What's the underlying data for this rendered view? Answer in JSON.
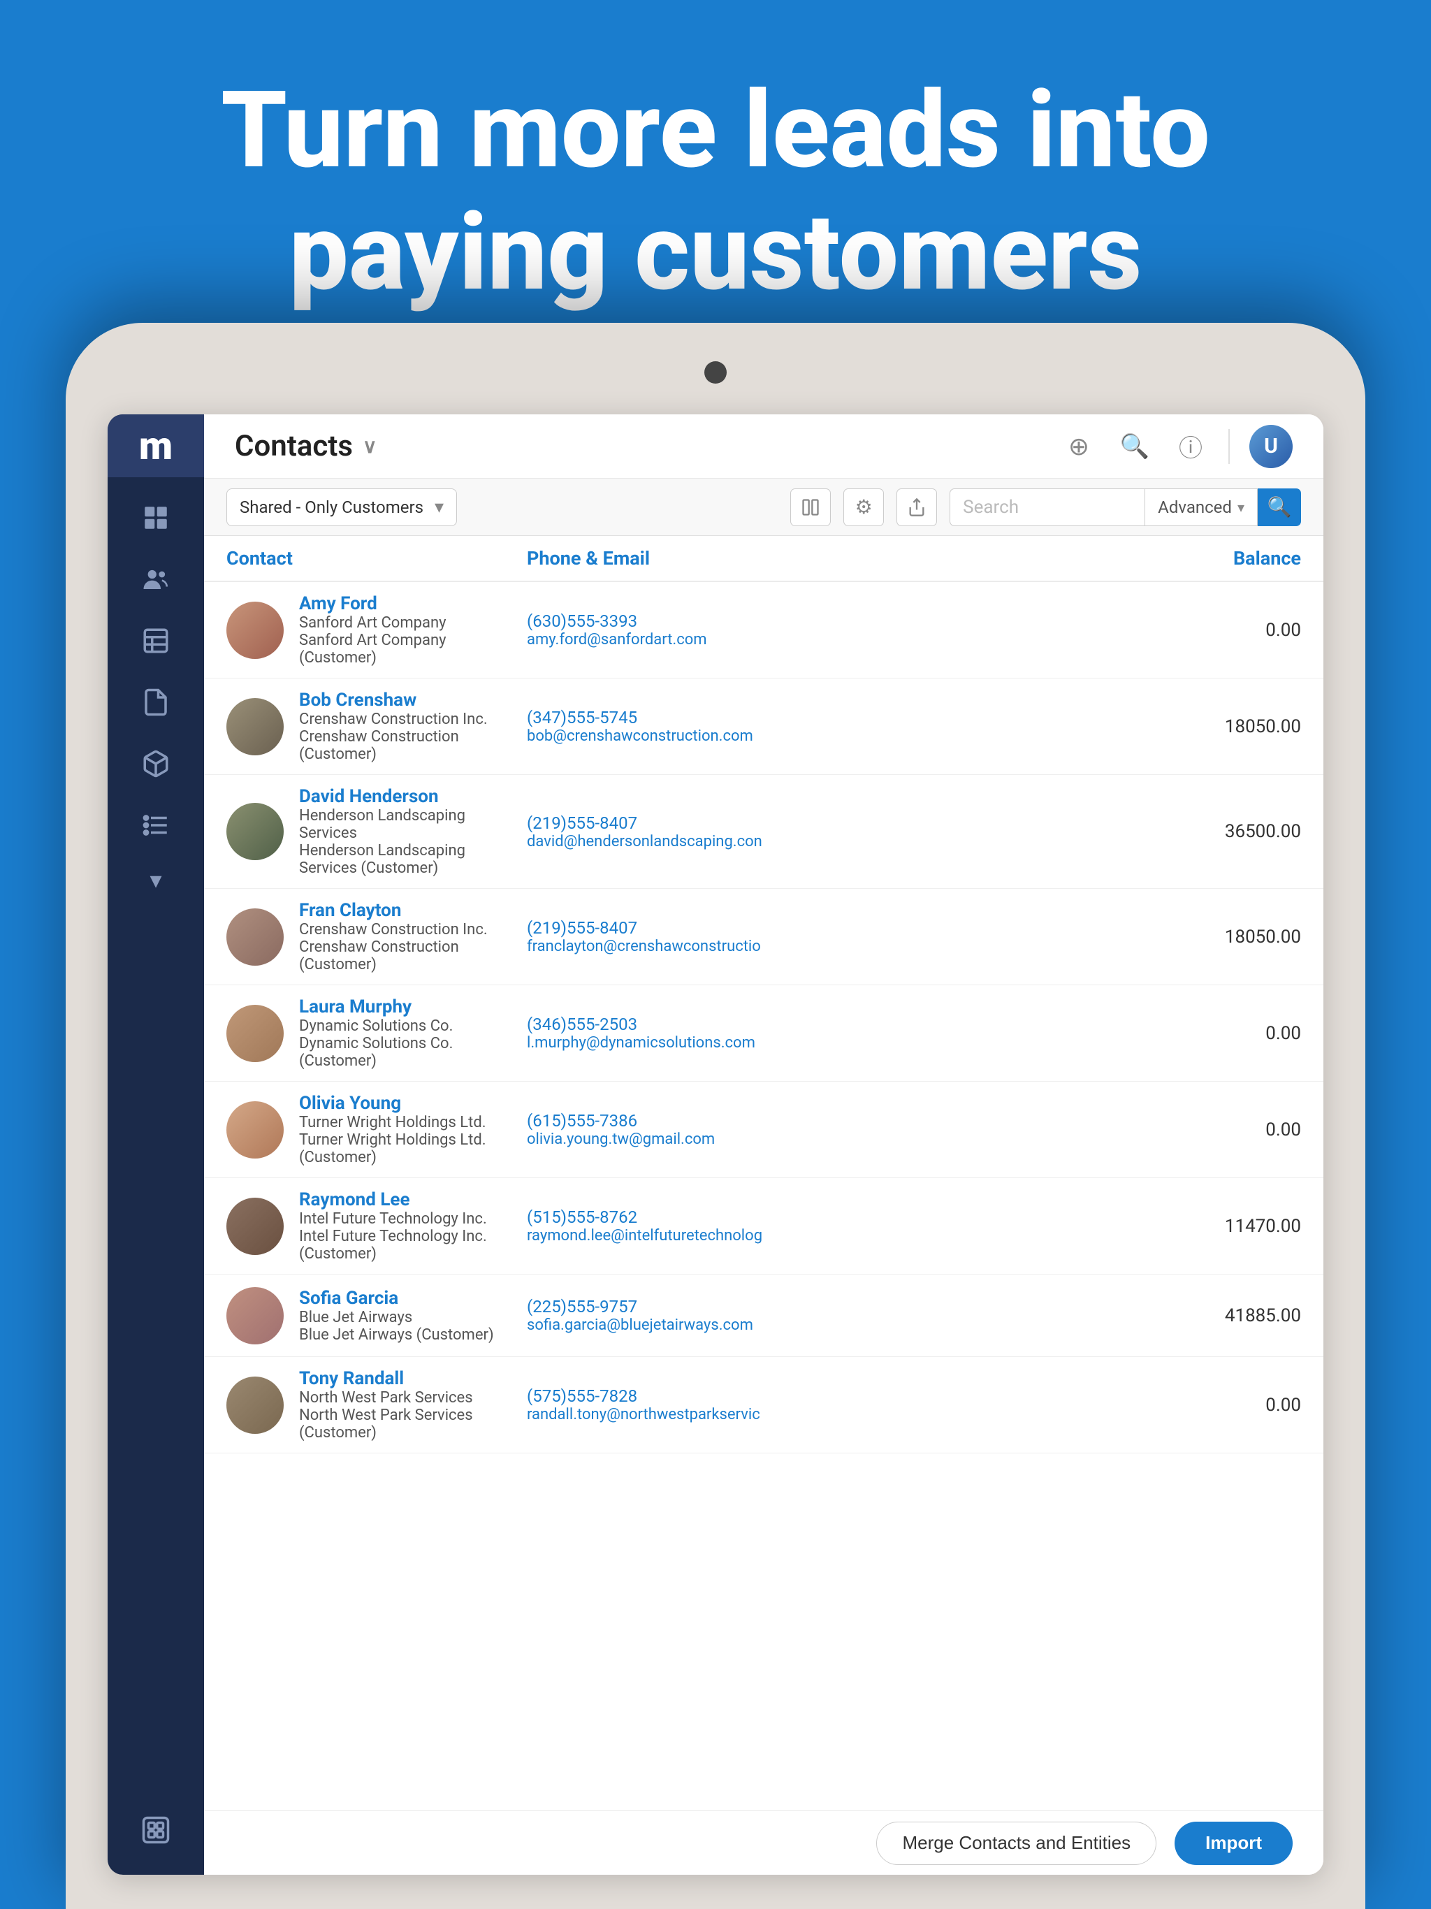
{
  "hero": {
    "line1": "Turn more leads into",
    "line2": "paying customers"
  },
  "topbar": {
    "title": "Contacts",
    "chevron": "∨",
    "avatar_label": "U"
  },
  "toolbar": {
    "filter_label": "Shared - Only Customers",
    "search_placeholder": "Search",
    "advanced_label": "Advanced",
    "search_icon": "🔍"
  },
  "table": {
    "columns": [
      "Contact",
      "Phone & Email",
      "Balance"
    ],
    "rows": [
      {
        "name": "Amy Ford",
        "company1": "Sanford Art Company",
        "company2": "Sanford Art Company (Customer)",
        "phone": "(630)555-3393",
        "email": "amy.ford@sanfordart.com",
        "balance": "0.00",
        "avatar_class": "av-amy"
      },
      {
        "name": "Bob Crenshaw",
        "company1": "Crenshaw Construction Inc.",
        "company2": "Crenshaw Construction (Customer)",
        "phone": "(347)555-5745",
        "email": "bob@crenshawconstruction.com",
        "balance": "18050.00",
        "avatar_class": "av-bob"
      },
      {
        "name": "David Henderson",
        "company1": "Henderson Landscaping Services",
        "company2": "Henderson Landscaping Services (Customer)",
        "phone": "(219)555-8407",
        "email": "david@hendersonlandscaping.con",
        "balance": "36500.00",
        "avatar_class": "av-david"
      },
      {
        "name": "Fran Clayton",
        "company1": "Crenshaw Construction Inc.",
        "company2": "Crenshaw Construction (Customer)",
        "phone": "(219)555-8407",
        "email": "franclayton@crenshawconstructio",
        "balance": "18050.00",
        "avatar_class": "av-fran"
      },
      {
        "name": "Laura Murphy",
        "company1": "Dynamic Solutions Co.",
        "company2": "Dynamic Solutions Co. (Customer)",
        "phone": "(346)555-2503",
        "email": "l.murphy@dynamicsolutions.com",
        "balance": "0.00",
        "avatar_class": "av-laura"
      },
      {
        "name": "Olivia Young",
        "company1": "Turner Wright Holdings Ltd.",
        "company2": "Turner Wright Holdings Ltd. (Customer)",
        "phone": "(615)555-7386",
        "email": "olivia.young.tw@gmail.com",
        "balance": "0.00",
        "avatar_class": "av-olivia"
      },
      {
        "name": "Raymond Lee",
        "company1": "Intel Future Technology Inc.",
        "company2": "Intel Future Technology Inc. (Customer)",
        "phone": "(515)555-8762",
        "email": "raymond.lee@intelfuturetechnolog",
        "balance": "11470.00",
        "avatar_class": "av-raymond"
      },
      {
        "name": "Sofia Garcia",
        "company1": "Blue Jet Airways",
        "company2": "Blue Jet Airways (Customer)",
        "phone": "(225)555-9757",
        "email": "sofia.garcia@bluejetairways.com",
        "balance": "41885.00",
        "avatar_class": "av-sofia"
      },
      {
        "name": "Tony Randall",
        "company1": "North West Park Services",
        "company2": "North West Park Services (Customer)",
        "phone": "(575)555-7828",
        "email": "randall.tony@northwestparkservic",
        "balance": "0.00",
        "avatar_class": "av-tony"
      }
    ]
  },
  "footer": {
    "merge_label": "Merge Contacts and Entities",
    "import_label": "Import"
  },
  "sidebar": {
    "logo": "m"
  }
}
